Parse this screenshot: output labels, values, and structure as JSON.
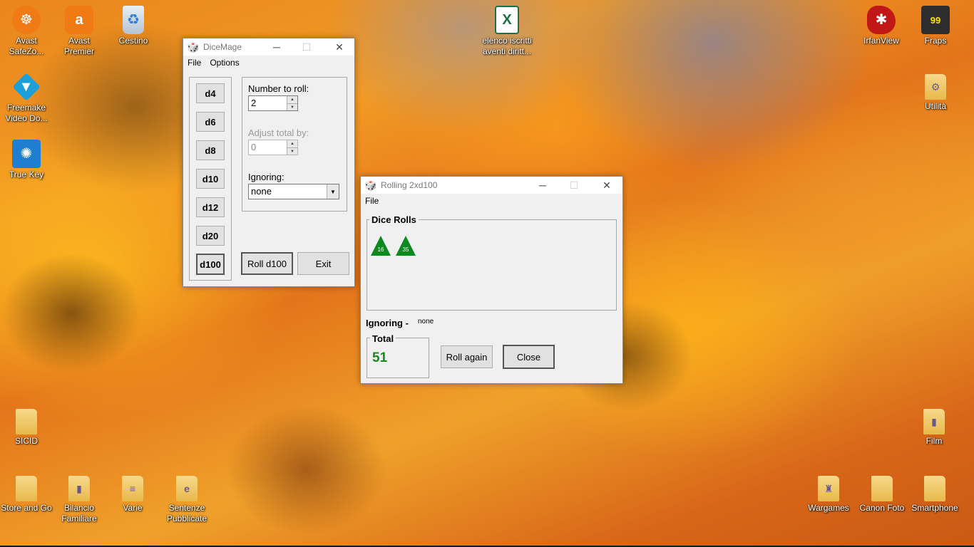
{
  "desktop": {
    "icons": [
      {
        "id": "avast-safezone",
        "label": "Avast SafeZo...",
        "glyph": "☸",
        "icon": "avast-safezone-icon"
      },
      {
        "id": "avast-premier",
        "label": "Avast Premier",
        "glyph": "a",
        "icon": "avast-premier-icon"
      },
      {
        "id": "cestino",
        "label": "Cestino",
        "glyph": "♻",
        "icon": "recycle-bin-icon"
      },
      {
        "id": "freemake",
        "label": "Freemake Video Do...",
        "glyph": "▼",
        "icon": "freemake-icon"
      },
      {
        "id": "truekey",
        "label": "True Key",
        "glyph": "✺",
        "icon": "true-key-icon"
      },
      {
        "id": "elenco",
        "label": "elenco iscritti aventi diritt...",
        "glyph": "X",
        "icon": "excel-file-icon"
      },
      {
        "id": "irfanview",
        "label": "IrfanView",
        "glyph": "✱",
        "icon": "irfanview-icon"
      },
      {
        "id": "fraps",
        "label": "Fraps",
        "glyph": "99",
        "icon": "fraps-icon"
      },
      {
        "id": "utilita",
        "label": "Utilità",
        "glyph": "⚙",
        "icon": "folder-icon"
      },
      {
        "id": "sicid",
        "label": "SICID",
        "glyph": "",
        "icon": "folder-icon"
      },
      {
        "id": "film",
        "label": "Film",
        "glyph": "▮",
        "icon": "folder-icon"
      },
      {
        "id": "store-and-go",
        "label": "Store and Go",
        "glyph": "",
        "icon": "folder-icon"
      },
      {
        "id": "bilancio",
        "label": "Bilancio Familiare",
        "glyph": "▮",
        "icon": "folder-icon"
      },
      {
        "id": "varie",
        "label": "Varie",
        "glyph": "≡",
        "icon": "folder-icon"
      },
      {
        "id": "sentenze",
        "label": "Sentenze Pubblicate",
        "glyph": "e",
        "icon": "folder-icon"
      },
      {
        "id": "wargames",
        "label": "Wargames",
        "glyph": "♜",
        "icon": "folder-icon"
      },
      {
        "id": "canon",
        "label": "Canon Foto",
        "glyph": "",
        "icon": "folder-icon"
      },
      {
        "id": "smartphone",
        "label": "Smartphone",
        "glyph": "",
        "icon": "folder-icon"
      }
    ]
  },
  "dicemage": {
    "title": "DiceMage",
    "menu": [
      "File",
      "Options"
    ],
    "dice_buttons": [
      "d4",
      "d6",
      "d8",
      "d10",
      "d12",
      "d20",
      "d100"
    ],
    "number_to_roll_label": "Number to roll:",
    "number_to_roll_value": "2",
    "adjust_label": "Adjust total by:",
    "adjust_value": "0",
    "ignoring_label": "Ignoring:",
    "ignoring_value": "none",
    "roll_button": "Roll d100",
    "exit_button": "Exit"
  },
  "rolling": {
    "title": "Rolling 2xd100",
    "menu": [
      "File"
    ],
    "dice_rolls_label": "Dice Rolls",
    "dice": [
      {
        "value": "16"
      },
      {
        "value": "35"
      }
    ],
    "die_color": "#0a8a1e",
    "ignoring_label": "Ignoring -",
    "ignoring_value": "none",
    "total_label": "Total",
    "total_value": "51",
    "total_color": "#1a8a1a",
    "roll_again_button": "Roll again",
    "close_button": "Close"
  }
}
